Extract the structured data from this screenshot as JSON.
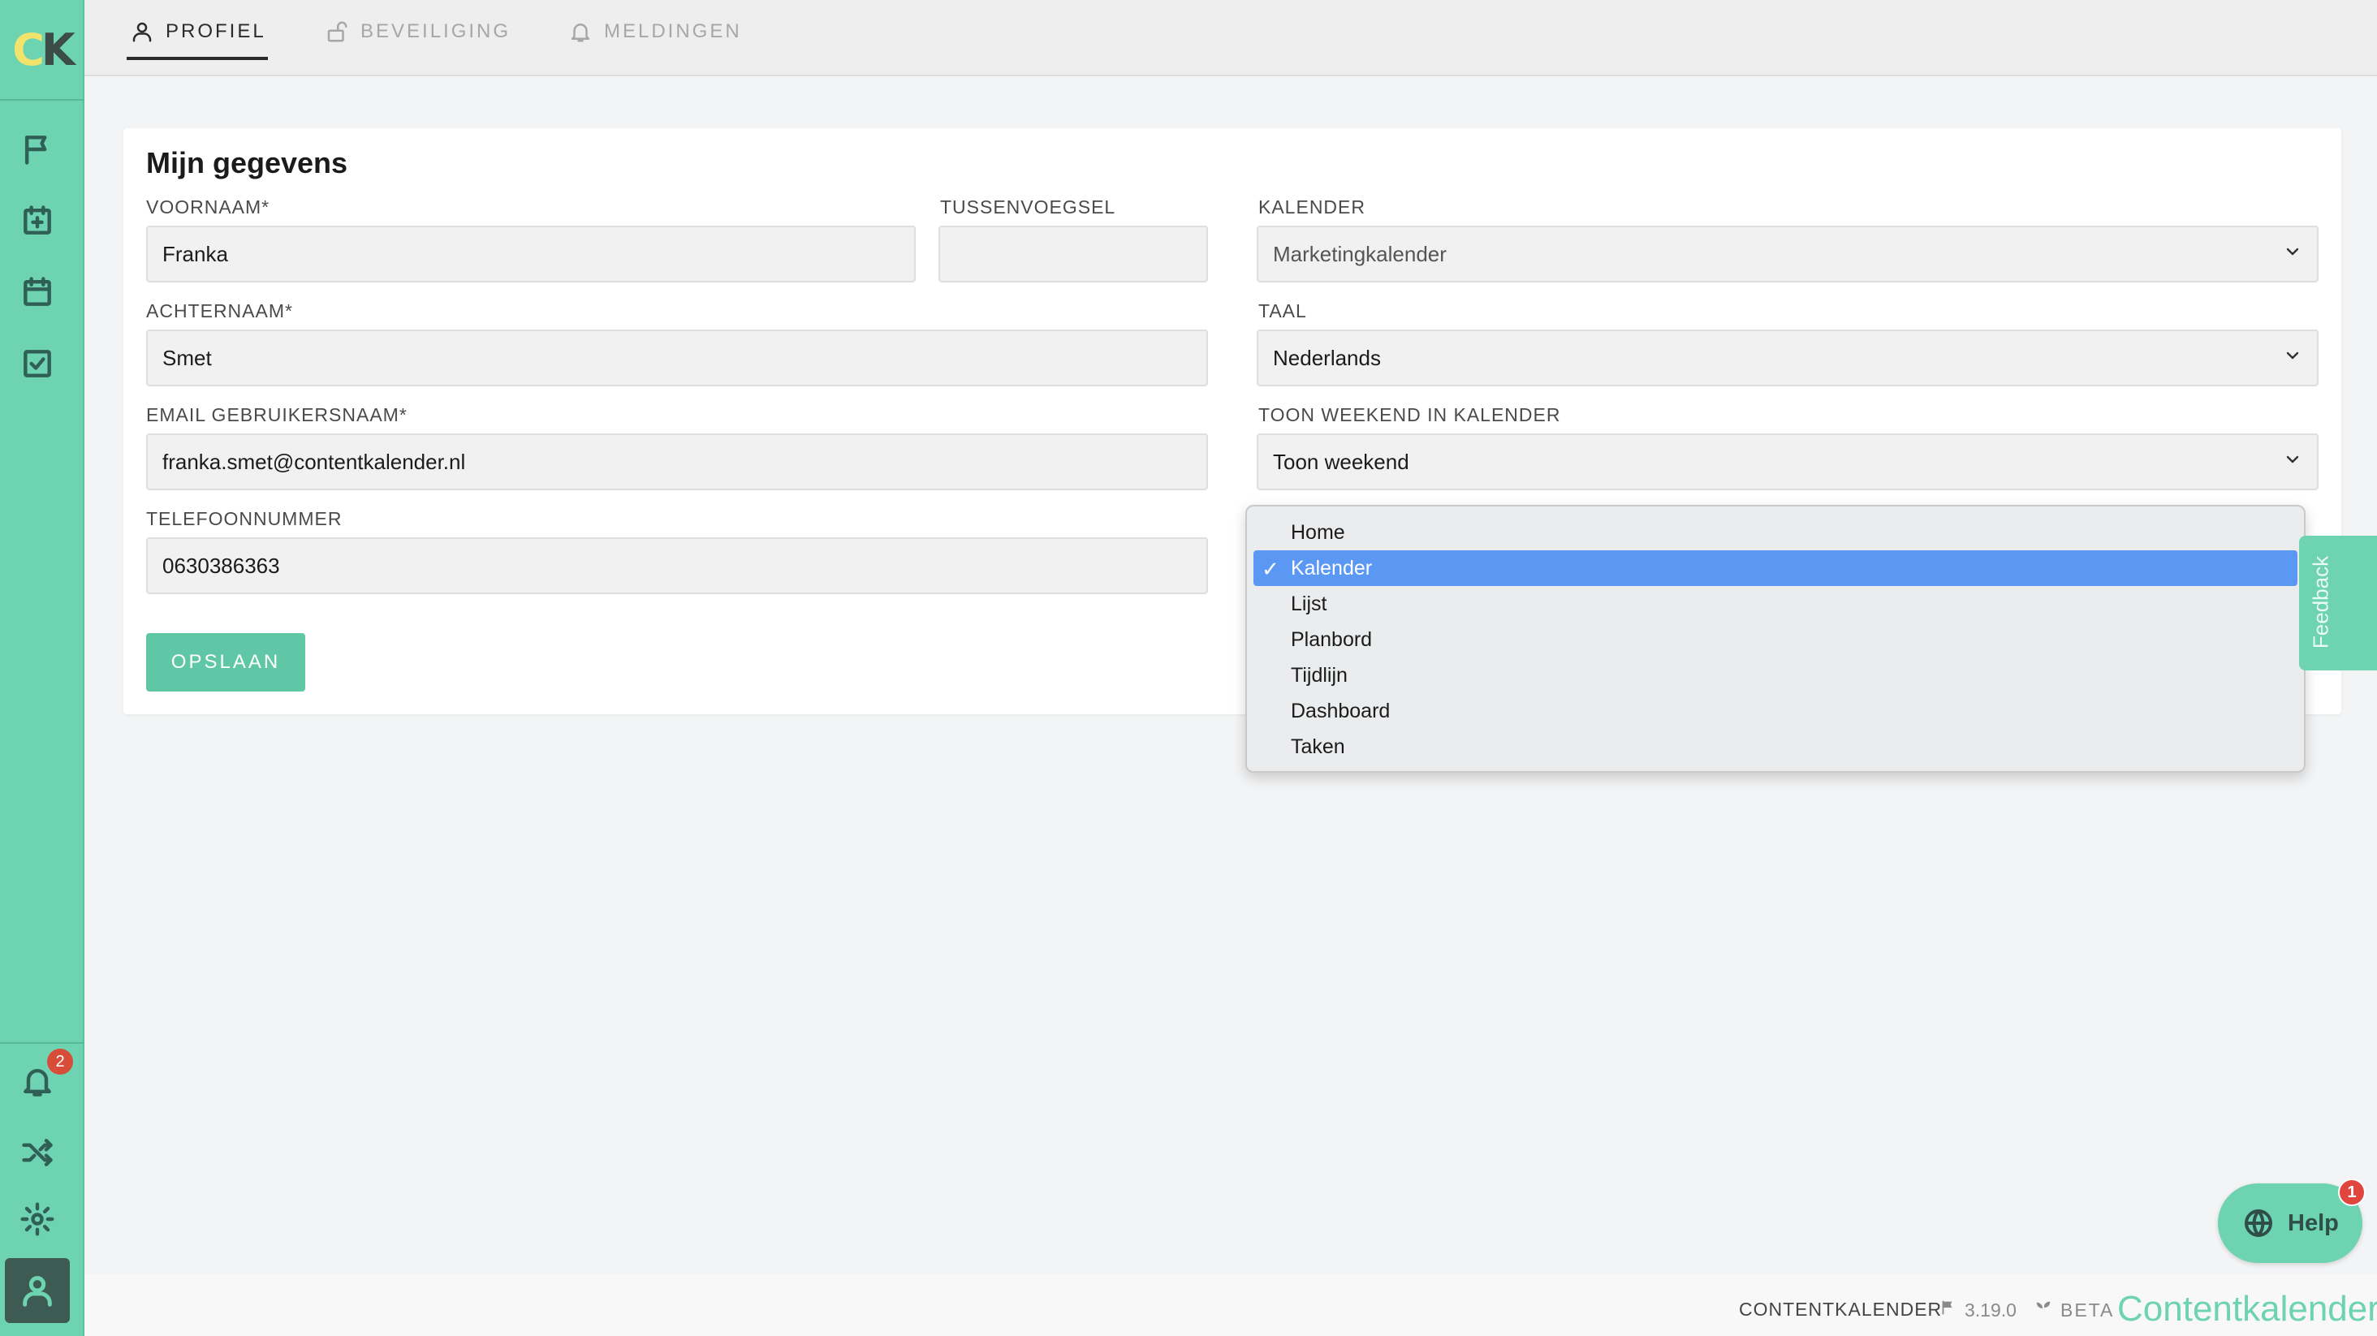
{
  "colors": {
    "sidebar": "#6ed3b0",
    "accent": "#5fc7a5",
    "selected_option": "#5b98f4",
    "badge": "#d84d3a"
  },
  "sidebar": {
    "logo": {
      "c": "C",
      "k": "K"
    },
    "items": [
      {
        "name": "flag-icon"
      },
      {
        "name": "calendar-plus-icon"
      },
      {
        "name": "calendar-icon"
      },
      {
        "name": "checkbox-icon"
      }
    ],
    "bottom_items": [
      {
        "name": "bell-icon",
        "badge": "2"
      },
      {
        "name": "shuffle-icon"
      },
      {
        "name": "gear-icon"
      },
      {
        "name": "user-icon"
      }
    ]
  },
  "tabs": [
    {
      "label": "PROFIEL",
      "icon": "user-icon",
      "active": true
    },
    {
      "label": "BEVEILIGING",
      "icon": "lock-icon",
      "active": false
    },
    {
      "label": "MELDINGEN",
      "icon": "bell-icon",
      "active": false
    }
  ],
  "form": {
    "title": "Mijn gegevens",
    "voornaam": {
      "label": "VOORNAAM*",
      "value": "Franka"
    },
    "tussenvoegsel": {
      "label": "TUSSENVOEGSEL",
      "value": ""
    },
    "achternaam": {
      "label": "ACHTERNAAM*",
      "value": "Smet"
    },
    "email": {
      "label": "EMAIL GEBRUIKERSNAAM*",
      "value": "franka.smet@contentkalender.nl"
    },
    "telefoon": {
      "label": "TELEFOONNUMMER",
      "value": "0630386363"
    },
    "kalender": {
      "label": "KALENDER",
      "value": "Marketingkalender"
    },
    "taal": {
      "label": "TAAL",
      "value": "Nederlands"
    },
    "weekend": {
      "label": "TOON WEEKEND IN KALENDER",
      "value": "Toon weekend"
    },
    "save_label": "OPSLAAN"
  },
  "dropdown": {
    "options": [
      "Home",
      "Kalender",
      "Lijst",
      "Planbord",
      "Tijdlijn",
      "Dashboard",
      "Taken"
    ],
    "selected": "Kalender",
    "check": "✓"
  },
  "feedback_label": "Feedback",
  "help": {
    "label": "Help",
    "badge": "1"
  },
  "footer": {
    "brand": "CONTENTKALENDER",
    "version": "3.19.0",
    "beta": "BETA",
    "logo_text": "Contentkalender"
  }
}
